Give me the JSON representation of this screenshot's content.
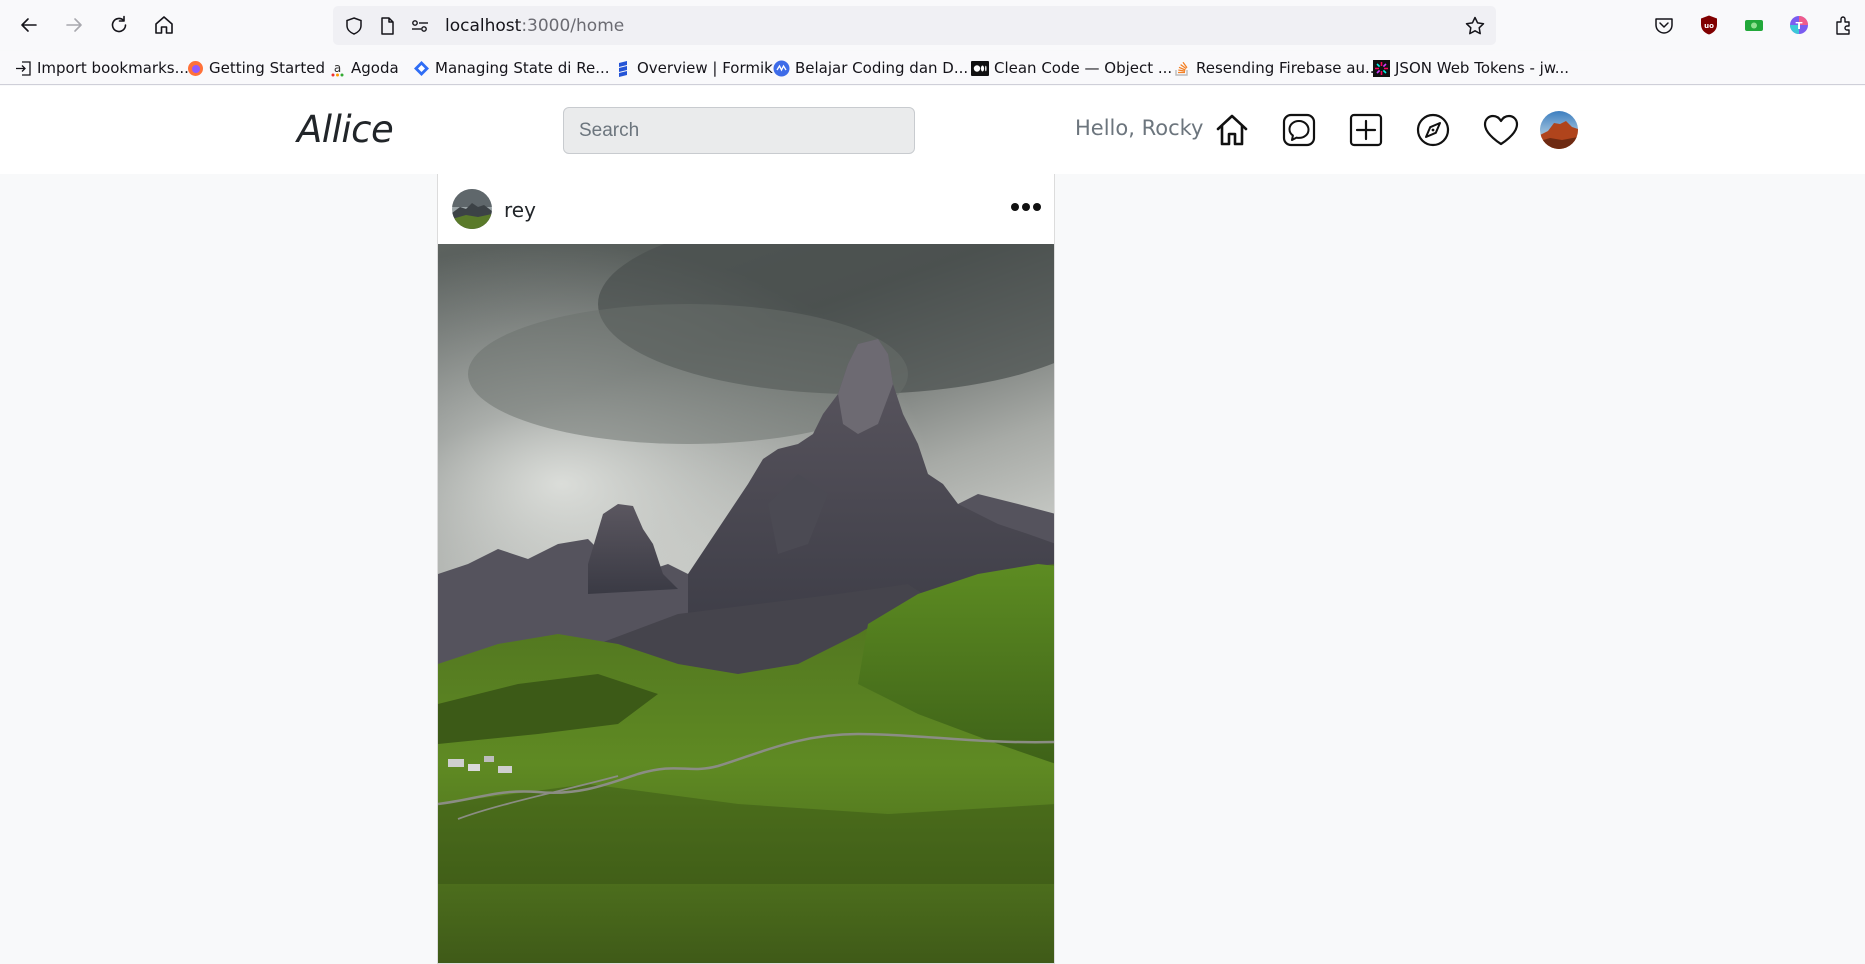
{
  "browser": {
    "url_host": "localhost",
    "url_path": ":3000/home",
    "bookmarks": [
      {
        "label": "Import bookmarks..."
      },
      {
        "label": "Getting Started"
      },
      {
        "label": "Agoda"
      },
      {
        "label": "Managing State di Re..."
      },
      {
        "label": "Overview | Formik"
      },
      {
        "label": "Belajar Coding dan D..."
      },
      {
        "label": "Clean Code — Object ..."
      },
      {
        "label": "Resending Firebase au..."
      },
      {
        "label": "JSON Web Tokens - jw..."
      }
    ]
  },
  "navbar": {
    "brand": "Allice",
    "search_placeholder": "Search",
    "greeting": "Hello, Rocky",
    "icons": [
      "home-icon",
      "messages-icon",
      "create-post-icon",
      "explore-icon",
      "likes-icon"
    ]
  },
  "post": {
    "username": "rey"
  }
}
